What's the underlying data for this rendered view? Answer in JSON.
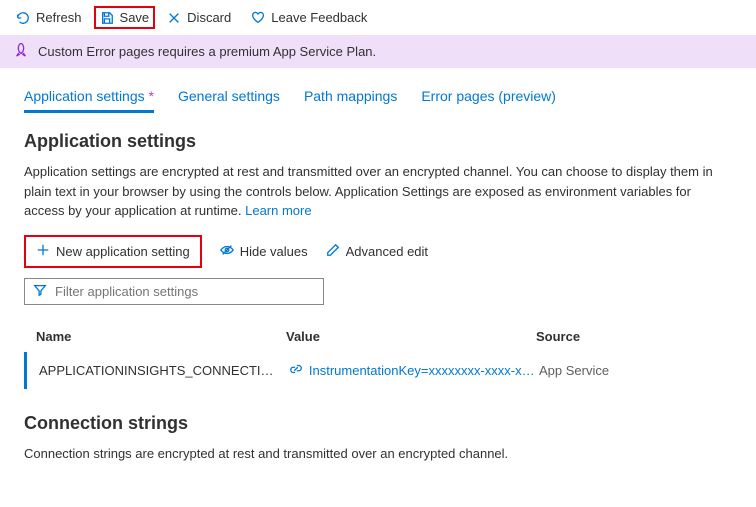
{
  "toolbar": {
    "refresh": "Refresh",
    "save": "Save",
    "discard": "Discard",
    "feedback": "Leave Feedback"
  },
  "banner": {
    "text": "Custom Error pages requires a premium App Service Plan."
  },
  "tabs": {
    "app_settings": "Application settings",
    "dirty_marker": "*",
    "general": "General settings",
    "path": "Path mappings",
    "error": "Error pages (preview)"
  },
  "appSettings": {
    "heading": "Application settings",
    "description": "Application settings are encrypted at rest and transmitted over an encrypted channel. You can choose to display them in plain text in your browser by using the controls below. Application Settings are exposed as environment variables for access by your application at runtime. ",
    "learnMore": "Learn more",
    "newSetting": "New application setting",
    "hideValues": "Hide values",
    "advancedEdit": "Advanced edit",
    "filterPlaceholder": "Filter application settings",
    "columns": {
      "name": "Name",
      "value": "Value",
      "source": "Source"
    },
    "rows": [
      {
        "name": "APPLICATIONINSIGHTS_CONNECTION_STRING",
        "value": "InstrumentationKey=xxxxxxxx-xxxx-xxxx",
        "source": "App Service"
      }
    ]
  },
  "connStrings": {
    "heading": "Connection strings",
    "description": "Connection strings are encrypted at rest and transmitted over an encrypted channel."
  }
}
